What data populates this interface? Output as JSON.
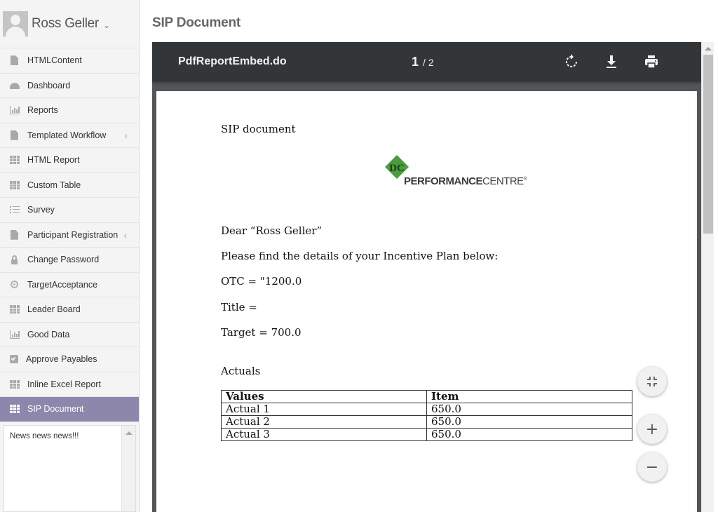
{
  "user": {
    "name": "Ross Geller"
  },
  "sidebar": {
    "items": [
      {
        "label": "HTMLContent",
        "icon": "document-icon"
      },
      {
        "label": "Dashboard",
        "icon": "dashboard-icon"
      },
      {
        "label": "Reports",
        "icon": "bar-chart-icon"
      },
      {
        "label": "Templated Workflow",
        "icon": "document-icon",
        "has_submenu": true
      },
      {
        "label": "HTML Report",
        "icon": "grid-icon"
      },
      {
        "label": "Custom Table",
        "icon": "grid-icon"
      },
      {
        "label": "Survey",
        "icon": "list-icon"
      },
      {
        "label": "Participant Registration",
        "icon": "document-icon",
        "has_submenu": true
      },
      {
        "label": "Change Password",
        "icon": "lock-icon"
      },
      {
        "label": "TargetAcceptance",
        "icon": "target-icon"
      },
      {
        "label": "Leader Board",
        "icon": "grid-icon"
      },
      {
        "label": "Good Data",
        "icon": "bar-chart-icon"
      },
      {
        "label": "Approve Payables",
        "icon": "checkbox-icon"
      },
      {
        "label": "Inline Excel Report",
        "icon": "grid-icon"
      },
      {
        "label": "SIP Document",
        "icon": "grid-icon",
        "active": true
      }
    ],
    "news": "News news news!!!"
  },
  "page": {
    "title": "SIP Document"
  },
  "viewer": {
    "filename": "PdfReportEmbed.do",
    "current_page": "1",
    "separator": "/",
    "total_pages": "2",
    "toolbar_icons": [
      "rotate-icon",
      "download-icon",
      "print-icon"
    ]
  },
  "document": {
    "heading": "SIP document",
    "logo": {
      "initials": "DC",
      "text_bold": "PERFORMANCE",
      "text_light": "CENTRE",
      "mark": "®"
    },
    "greeting": "Dear “Ross Geller”",
    "intro": "Please find the details of your Incentive Plan below:",
    "otc": "OTC = \"1200.0",
    "title_line": "Title =",
    "target": "Target = 700.0",
    "actuals_heading": "Actuals",
    "table": {
      "headers": [
        "Values",
        "Item"
      ],
      "rows": [
        [
          "Actual 1",
          "650.0"
        ],
        [
          "Actual 2",
          "650.0"
        ],
        [
          "Actual 3",
          "650.0"
        ]
      ]
    }
  },
  "controls": {
    "fit_icon": "fit-to-page-icon",
    "zoom_in_label": "+",
    "zoom_out_label": "−"
  },
  "colors": {
    "active_nav": "#8d88ab",
    "viewer_toolbar": "#323639",
    "viewer_background": "#525659",
    "logo_green": "#4a9c3c"
  }
}
